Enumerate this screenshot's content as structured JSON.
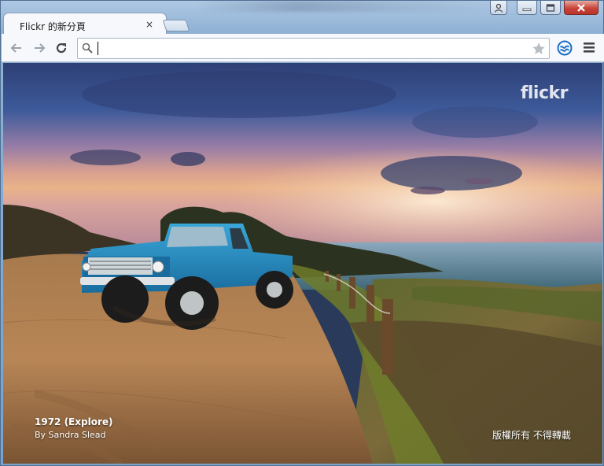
{
  "window": {
    "controls": [
      "user-icon",
      "minimize-icon",
      "maximize-icon",
      "close-icon"
    ]
  },
  "tab": {
    "title": "Flickr 的新分頁",
    "close_label": "×"
  },
  "omnibox": {
    "value": "",
    "placeholder": ""
  },
  "toolbar_icons": [
    "back-arrow-icon",
    "forward-arrow-icon",
    "reload-icon",
    "search-icon",
    "bookmark-star-icon",
    "extension-icon",
    "menu-icon"
  ],
  "page": {
    "logo": "flickr",
    "photo_title": "1972 (Explore)",
    "photo_author": "By Sandra Slead",
    "copyright": "版權所有 不得轉載"
  },
  "colors": {
    "accent_blue": "#1a6fc7",
    "window_frame": "#8fb1d4",
    "close_red": "#c9453a"
  }
}
